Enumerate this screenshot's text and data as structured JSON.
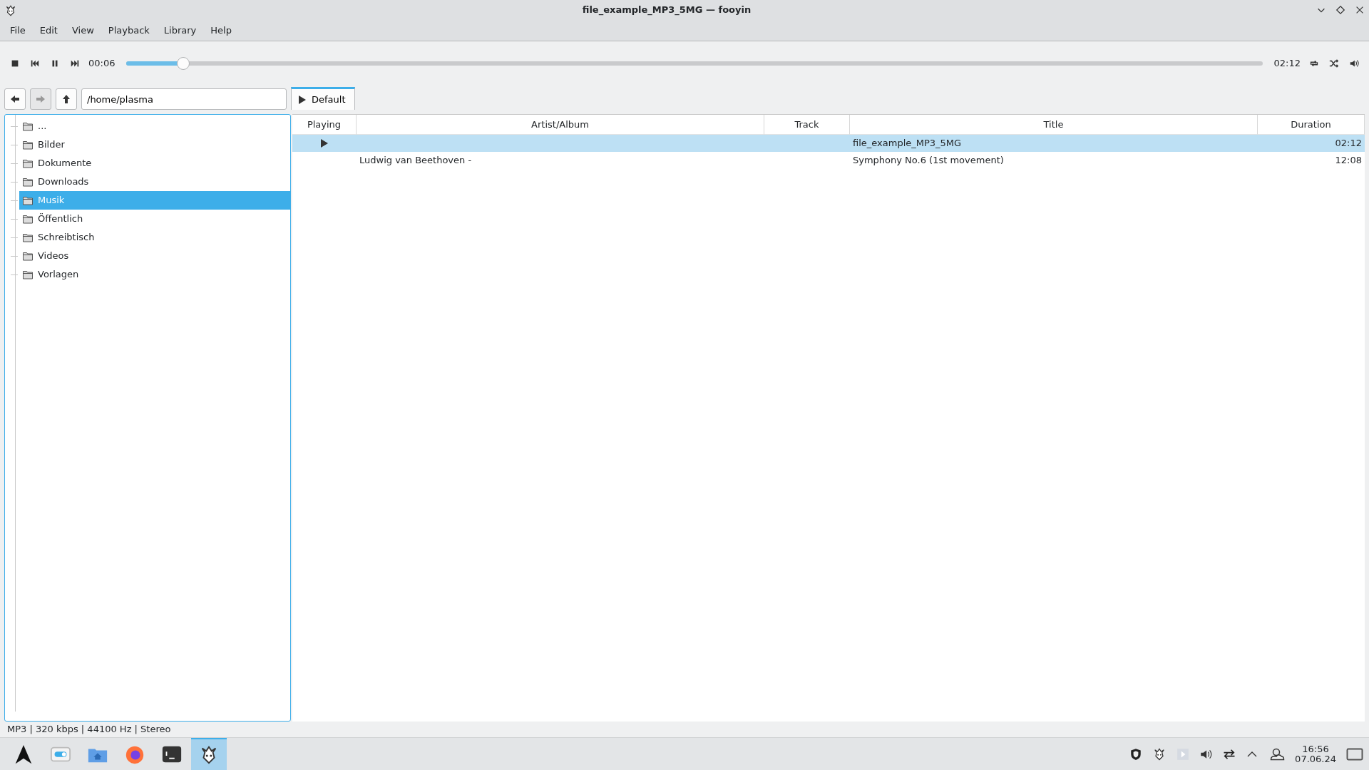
{
  "window": {
    "title": "file_example_MP3_5MG — fooyin"
  },
  "menu": [
    "File",
    "Edit",
    "View",
    "Playback",
    "Library",
    "Help"
  ],
  "player": {
    "elapsed": "00:06",
    "total": "02:12",
    "level": 0.05
  },
  "navigator": {
    "path": "/home/plasma",
    "forward_disabled": true
  },
  "tabs": [
    {
      "label": "Default",
      "selected": true
    }
  ],
  "tree": [
    {
      "label": "...",
      "selected": false
    },
    {
      "label": "Bilder",
      "selected": false
    },
    {
      "label": "Dokumente",
      "selected": false
    },
    {
      "label": "Downloads",
      "selected": false
    },
    {
      "label": "Musik",
      "selected": true
    },
    {
      "label": "Öffentlich",
      "selected": false
    },
    {
      "label": "Schreibtisch",
      "selected": false
    },
    {
      "label": "Videos",
      "selected": false
    },
    {
      "label": "Vorlagen",
      "selected": false
    }
  ],
  "table": {
    "columns": [
      "Playing",
      "Artist/Album",
      "Track",
      "Title",
      "Duration"
    ],
    "rows": [
      {
        "playing": true,
        "selected": true,
        "artist_album": "",
        "title": "file_example_MP3_5MG",
        "duration": "02:12"
      },
      {
        "playing": false,
        "selected": false,
        "artist_album": "Ludwig van Beethoven -",
        "title": "Symphony No.6 (1st movement)",
        "duration": "12:08"
      }
    ]
  },
  "status_bar": "MP3 | 320 kbps | 44100 Hz | Stereo",
  "taskbar": [
    {
      "kind": "launcher",
      "active": false
    },
    {
      "kind": "settings",
      "active": false
    },
    {
      "kind": "files",
      "active": false
    },
    {
      "kind": "browser",
      "active": false
    },
    {
      "kind": "terminal",
      "active": false
    },
    {
      "kind": "player",
      "active": true
    }
  ],
  "clock": {
    "time": "16:56",
    "date": "07.06.24"
  }
}
